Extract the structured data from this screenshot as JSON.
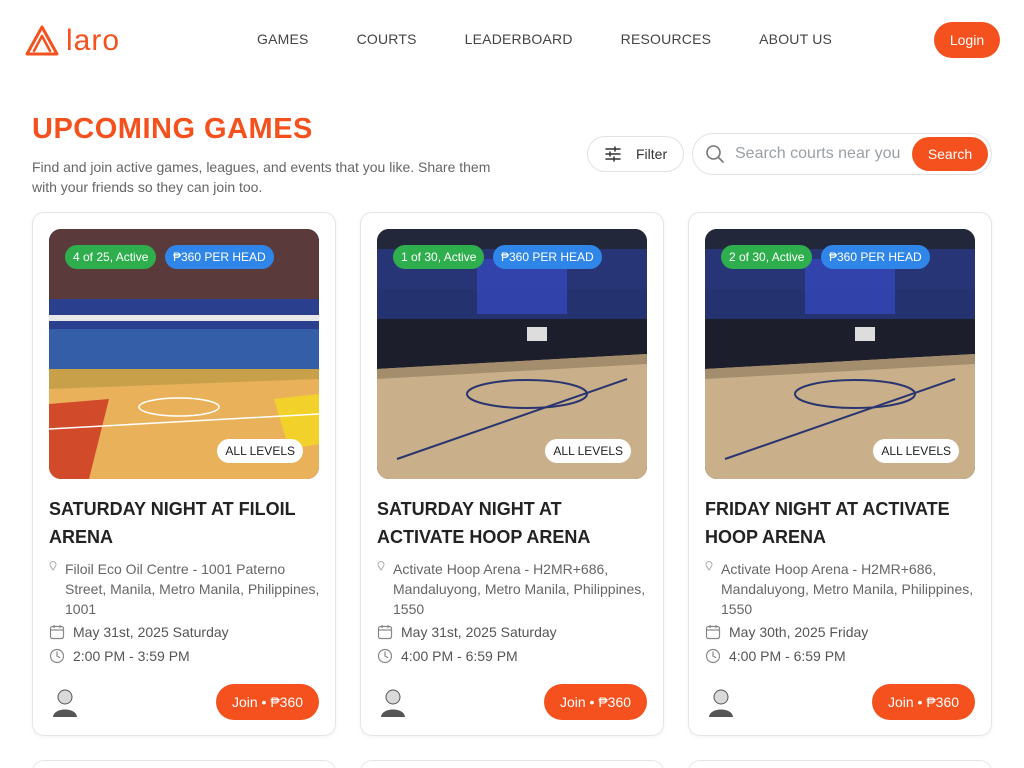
{
  "brand": {
    "name": "Laro",
    "logo_text": "laro",
    "accent_color": "#f4511e"
  },
  "nav": {
    "items": [
      "GAMES",
      "COURTS",
      "LEADERBOARD",
      "RESOURCES",
      "ABOUT US"
    ]
  },
  "header": {
    "login_label": "Login"
  },
  "page": {
    "title": "UPCOMING GAMES",
    "subtitle": "Find and join active games, leagues, and events that you like. Share them with your friends so they can join too."
  },
  "toolbar": {
    "filter_label": "Filter",
    "filter_icon": "sliders-icon",
    "search_placeholder": "Search courts near you",
    "search_value": "",
    "search_label": "Search",
    "search_icon": "magnifier-icon"
  },
  "cards": [
    {
      "slots": "4 of 25, Active",
      "price_badge": "₱360 PER HEAD",
      "level": "ALL LEVELS",
      "title": "SATURDAY NIGHT AT FILOIL ARENA",
      "address": "Filoil Eco Oil Centre - 1001 Paterno Street, Manila, Metro Manila, Philippines, 1001",
      "date": "May 31st, 2025 Saturday",
      "time": "2:00 PM - 3:59 PM",
      "join_label": "Join • ₱360",
      "image": "filoil-arena-photo"
    },
    {
      "slots": "1 of 30, Active",
      "price_badge": "₱360 PER HEAD",
      "level": "ALL LEVELS",
      "title": "SATURDAY NIGHT AT ACTIVATE HOOP ARENA",
      "address": "Activate Hoop Arena - H2MR+686, Mandaluyong, Metro Manila, Philippines, 1550",
      "date": "May 31st, 2025 Saturday",
      "time": "4:00 PM - 6:59 PM",
      "join_label": "Join • ₱360",
      "image": "activate-hoop-arena-photo"
    },
    {
      "slots": "2 of 30, Active",
      "price_badge": "₱360 PER HEAD",
      "level": "ALL LEVELS",
      "title": "FRIDAY NIGHT AT ACTIVATE HOOP ARENA",
      "address": "Activate Hoop Arena - H2MR+686, Mandaluyong, Metro Manila, Philippines, 1550",
      "date": "May 30th, 2025 Friday",
      "time": "4:00 PM - 6:59 PM",
      "join_label": "Join • ₱360",
      "image": "activate-hoop-arena-photo"
    }
  ],
  "colors": {
    "active_badge": "#2fae4d",
    "price_badge": "#2f86e8",
    "accent": "#f4511e"
  }
}
